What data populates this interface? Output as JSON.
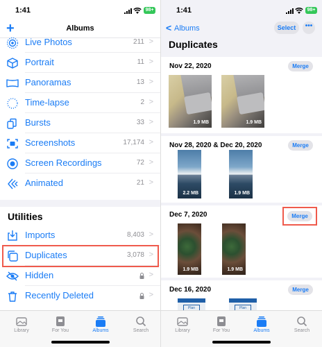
{
  "status": {
    "time": "1:41",
    "battery": "98+"
  },
  "left": {
    "nav_title": "Albums",
    "media_types": [
      {
        "label": "Live Photos",
        "count": "211",
        "icon": "live-photo-icon"
      },
      {
        "label": "Portrait",
        "count": "11",
        "icon": "cube-icon"
      },
      {
        "label": "Panoramas",
        "count": "13",
        "icon": "panorama-icon"
      },
      {
        "label": "Time-lapse",
        "count": "2",
        "icon": "timelapse-icon"
      },
      {
        "label": "Bursts",
        "count": "33",
        "icon": "bursts-icon"
      },
      {
        "label": "Screenshots",
        "count": "17,174",
        "icon": "screenshot-icon"
      },
      {
        "label": "Screen Recordings",
        "count": "72",
        "icon": "record-icon"
      },
      {
        "label": "Animated",
        "count": "21",
        "icon": "animated-icon"
      }
    ],
    "utilities_title": "Utilities",
    "utilities": [
      {
        "label": "Imports",
        "count": "8,403",
        "icon": "import-icon"
      },
      {
        "label": "Duplicates",
        "count": "3,078",
        "icon": "duplicates-icon"
      },
      {
        "label": "Hidden",
        "count": "",
        "icon": "eye-slash-icon"
      },
      {
        "label": "Recently Deleted",
        "count": "",
        "icon": "trash-icon"
      }
    ]
  },
  "tabs": [
    {
      "label": "Library",
      "icon": "photo-library-icon"
    },
    {
      "label": "For You",
      "icon": "for-you-icon"
    },
    {
      "label": "Albums",
      "icon": "albums-icon"
    },
    {
      "label": "Search",
      "icon": "search-icon"
    }
  ],
  "active_tab": "Albums",
  "right": {
    "back_label": "Albums",
    "select_label": "Select",
    "more_label": "•••",
    "title": "Duplicates",
    "merge_label": "Merge",
    "groups": [
      {
        "date": "Nov 22, 2020",
        "sizes": [
          "1.9 MB",
          "1.9 MB"
        ]
      },
      {
        "date": "Nov 28, 2020 & Dec 20, 2020",
        "sizes": [
          "2.2 MB",
          "1.9 MB"
        ]
      },
      {
        "date": "Dec 7, 2020",
        "sizes": [
          "1.9 MB",
          "1.9 MB"
        ]
      },
      {
        "date": "Dec 16, 2020",
        "sizes": [],
        "thumb_texts": [
          "Plan Selected. One last step",
          "Plan Selected. One last step"
        ]
      }
    ]
  },
  "colors": {
    "accent": "#1a7cf5",
    "highlight": "#ef5a4c",
    "battery": "#34c759"
  }
}
